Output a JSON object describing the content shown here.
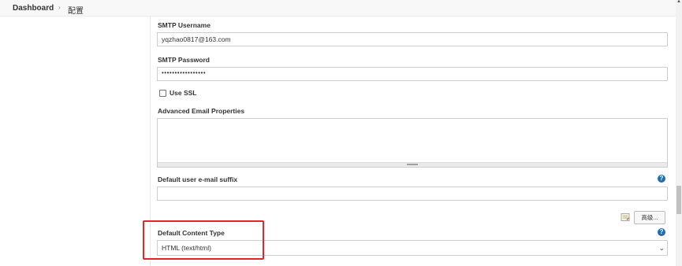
{
  "breadcrumb": {
    "home": "Dashboard",
    "current": "配置"
  },
  "form": {
    "smtp_username_label": "SMTP Username",
    "smtp_username_value": "yqzhao0817@163.com",
    "smtp_password_label": "SMTP Password",
    "smtp_password_value": "•••••••••••••••••",
    "use_ssl_label": "Use SSL",
    "use_ssl_checked": false,
    "advanced_email_label": "Advanced Email Properties",
    "default_suffix_label": "Default user e-mail suffix",
    "advanced_button_label": "高级...",
    "content_type_label": "Default Content Type",
    "content_type_value": "HTML (text/html)"
  },
  "icons": {
    "help": "help-icon",
    "notepad": "notepad-icon",
    "chevron": "chevron-down-icon"
  },
  "colors": {
    "highlight": "#e4262b",
    "help": "#1f6db3"
  }
}
